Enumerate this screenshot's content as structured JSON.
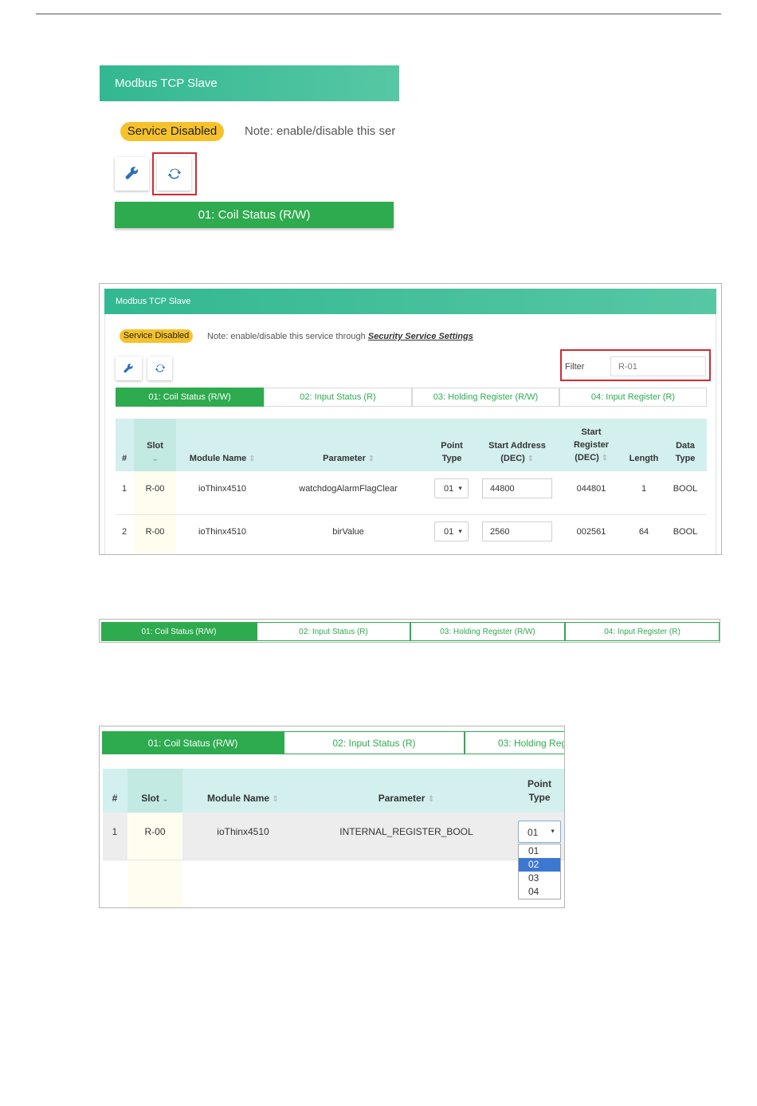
{
  "title": "Modbus TCP Slave",
  "service_status": "Service Disabled",
  "note_prefix": "Note: enable/disable this service through ",
  "note_link": "Security Service Settings",
  "note_short": "Note: enable/disable this ser",
  "icons": {
    "settings": "wrench-icon",
    "refresh": "refresh-icon"
  },
  "colors": {
    "header": "#3dbd97",
    "tab_active": "#2eab4e",
    "badge": "#f6c22b",
    "highlight": "#cf2b36",
    "table_header": "#d3f0ee",
    "slot_bg": "#fffdf0"
  },
  "filter": {
    "label": "Filter",
    "value": "R-01"
  },
  "tabs": [
    "01: Coil Status (R/W)",
    "02: Input Status (R)",
    "03: Holding Register (R/W)",
    "04: Input Register (R)"
  ],
  "tab3_partial": "03: Holding Reg",
  "columns": {
    "num": "#",
    "slot": "Slot",
    "module": "Module Name",
    "parameter": "Parameter",
    "point_type": "Point Type",
    "start_address": "Start Address (DEC)",
    "start_register": "Start Register (DEC)",
    "length": "Length",
    "data_type": "Data Type"
  },
  "rows": [
    {
      "num": "1",
      "slot": "R-00",
      "module": "ioThinx4510",
      "parameter": "watchdogAlarmFlagClear",
      "point_type": "01",
      "start_address": "44800",
      "start_register": "044801",
      "length": "1",
      "data_type": "BOOL"
    },
    {
      "num": "2",
      "slot": "R-00",
      "module": "ioThinx4510",
      "parameter": "birValue",
      "point_type": "01",
      "start_address": "2560",
      "start_register": "002561",
      "length": "64",
      "data_type": "BOOL"
    }
  ],
  "dropdown_row": {
    "num": "1",
    "slot": "R-00",
    "module": "ioThinx4510",
    "parameter": "INTERNAL_REGISTER_BOOL",
    "point_type": "01"
  },
  "point_type_options": [
    "01",
    "02",
    "03",
    "04"
  ],
  "point_type_highlighted": "02"
}
